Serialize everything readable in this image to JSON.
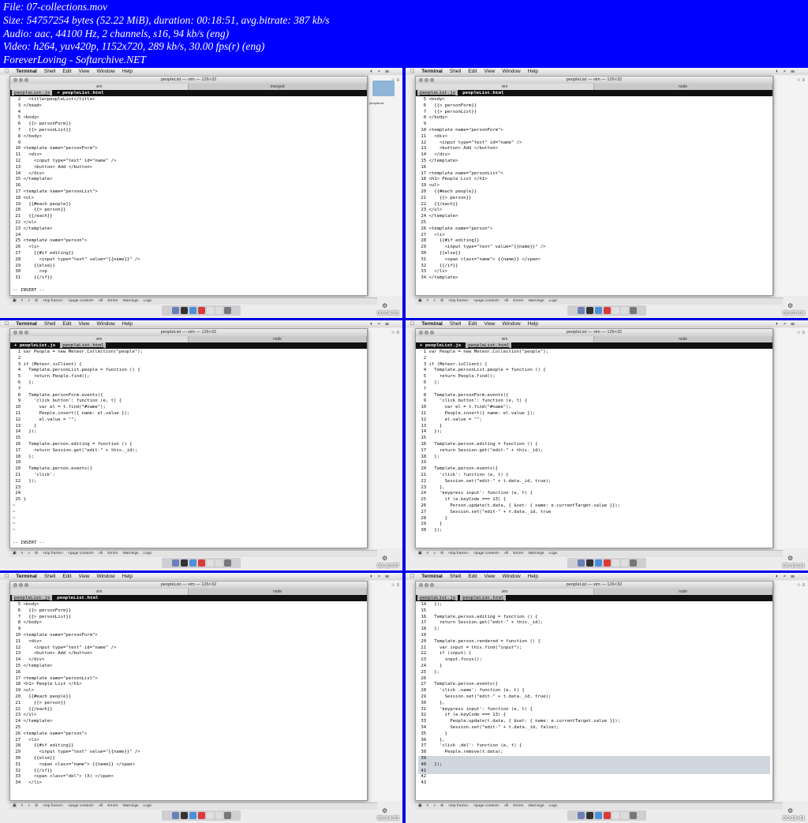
{
  "header": {
    "lines": [
      "File: 07-collections.mov",
      "Size: 54757254 bytes (52.22 MiB), duration: 00:18:51, avg.bitrate: 387 kb/s",
      "Audio: aac, 44100 Hz, 2 channels, s16, 94 kb/s (eng)",
      "Video: h264, yuv420p, 1152x720, 289 kb/s, 30.00 fps(r) (eng)",
      "ForeverLoving - Softarchive.NET"
    ]
  },
  "menubar": {
    "app": "Terminal",
    "items": [
      "Shell",
      "Edit",
      "View",
      "Window",
      "Help"
    ]
  },
  "window": {
    "title": "peopleList — vim — 126×32"
  },
  "devtools": {
    "top_frame": "<top frame>",
    "page_context": "<page context>",
    "count": "All",
    "errors": "Errors",
    "warnings": "Warnings",
    "logs": "Logs"
  },
  "panels": [
    {
      "timestamp": "00:04:51",
      "tabs": [
        "vim",
        "mongod"
      ],
      "buffers": [
        {
          "label": "peopleList.js",
          "active": false
        },
        {
          "label": "+ peopleList.html",
          "active": true
        }
      ],
      "show_folder": true,
      "folder_label": "peopleList",
      "insert_mode": "-- INSERT --",
      "lines": [
        "  2   <title>peopleList</title>",
        "  3 </head>",
        "  4",
        "  5 <body>",
        "  6   {{> personForm}}",
        "  7   {{> personList}}",
        "  8 </body>",
        "  9",
        " 10 <template name=\"personForm\">",
        " 11   <div>",
        " 12     <input type=\"text\" id=\"name\" />",
        " 13     <button> Add </button>",
        " 14   </div>",
        " 15 </template>",
        " 16",
        " 17 <template name=\"personList\">",
        " 18 <ul>",
        " 19   {{#each people}}",
        " 20     {{> person}}",
        " 21   {{/each}}",
        " 22 </ul>",
        " 23 </template>",
        " 24",
        " 25 <template name=\"person\">",
        " 26   <li>",
        " 27     {{#if editing}}",
        " 28       <input type=\"text\" value=\"{{name}}\" />",
        " 29     {{else}}",
        " 30       <sp",
        " 31     {{/if}}"
      ]
    },
    {
      "timestamp": "00:07:09",
      "tabs": [
        "vim",
        "node"
      ],
      "buffers": [
        {
          "label": "peopleList.js",
          "active": false
        },
        {
          "label": "peopleList.html",
          "active": true
        }
      ],
      "show_folder": false,
      "insert_mode": "",
      "lines": [
        "  5 <body>",
        "  6   {{> personForm}}",
        "  7   {{> personList}}",
        "  8 </body>",
        "  9",
        " 10 <template name=\"personForm\">",
        " 11   <div>",
        " 12     <input type=\"text\" id=\"name\" />",
        " 13     <button> Add </button>",
        " 14   </div>",
        " 15 </template>",
        " 16",
        " 17 <template name=\"personList\">",
        " 18 <h1> People List </h1>",
        " 19 <ul>",
        " 20   {{#each people}}",
        " 21     {{> person}}",
        " 22   {{/each}}",
        " 23 </ul>",
        " 24 </template>",
        " 25",
        " 26 <template name=\"person\">",
        " 27   <li>",
        " 28     {{#if editing}}",
        " 29       <input type=\"text\" value=\"{{name}}\" />",
        " 30     {{else}}",
        " 31       <span class=\"name\"> {{name}} </span>",
        " 32     {{/if}}",
        " 33   </li>",
        " 34 </template>"
      ]
    },
    {
      "timestamp": "00:10:37",
      "tabs": [
        "vim",
        "node"
      ],
      "buffers": [
        {
          "label": "+ peopleList.js",
          "active": true
        },
        {
          "label": "peopleList.html",
          "active": false
        }
      ],
      "show_folder": false,
      "insert_mode": "-- INSERT --",
      "lines": [
        "  1 var People = new Meteor.Collection(\"people\");",
        "  2",
        "  3 if (Meteor.isClient) {",
        "  4   Template.personList.people = function () {",
        "  5     return People.find();",
        "  6   };",
        "  7",
        "  8   Template.personForm.events({",
        "  9     'click button': function (e, t) {",
        " 10       var el = t.find(\"#name\");",
        " 11       People.insert({ name: el.value });",
        " 12       el.value = \"\";",
        " 13     }",
        " 14   });",
        " 15",
        " 16   Template.person.editing = function () {",
        " 17     return Session.get(\"edit-\" + this._id);",
        " 18   };",
        " 19",
        " 20   Template.person.events({",
        " 21     'click': ",
        " 22   });",
        " 23",
        " 24",
        " 25 }",
        "~",
        "~",
        "~",
        "~",
        "~"
      ]
    },
    {
      "timestamp": "00:13:31",
      "tabs": [
        "vim",
        "node"
      ],
      "buffers": [
        {
          "label": "+ peopleList.js",
          "active": true
        },
        {
          "label": "peopleList.html",
          "active": false
        }
      ],
      "show_folder": false,
      "insert_mode": "",
      "lines": [
        "  1 var People = new Meteor.Collection(\"people\");",
        "  2",
        "  3 if (Meteor.isClient) {",
        "  4   Template.personList.people = function () {",
        "  5     return People.find();",
        "  6   };",
        "  7",
        "  8   Template.personForm.events({",
        "  9     'click button': function (e, t) {",
        " 10       var el = t.find(\"#name\");",
        " 11       People.insert({ name: el.value });",
        " 12       el.value = \"\";",
        " 13     }",
        " 14   });",
        " 15",
        " 16   Template.person.editing = function () {",
        " 17     return Session.get(\"edit-\" + this._id);",
        " 18   };",
        " 19",
        " 20   Template.person.events({",
        " 21     'click': function (e, t) {",
        " 22       Session.set(\"edit-\" + t.data._id, true);",
        " 23     },",
        " 24     'keypress input': function (e, t) {",
        " 25       if (e.keyCode === 13) {",
        " 26         Person.update(t.data, { $set: { name: e.currentTarget.value }});",
        " 27         Session.set(\"edit-\" + t.data._id, true",
        " 28       }",
        " 29     }",
        " 30   });"
      ]
    },
    {
      "timestamp": "00:14:53",
      "tabs": [
        "vim",
        "node"
      ],
      "buffers": [
        {
          "label": "peopleList.js",
          "active": false
        },
        {
          "label": "peopleList.html",
          "active": true
        }
      ],
      "show_folder": false,
      "insert_mode": "",
      "lines": [
        "  5 <body>",
        "  6   {{> personForm}}",
        "  7   {{> personList}}",
        "  8 </body>",
        "  9",
        " 10 <template name=\"personForm\">",
        " 11   <div>",
        " 12     <input type=\"text\" id=\"name\" />",
        " 13     <button> Add </button>",
        " 14   </div>",
        " 15 </template>",
        " 16",
        " 17 <template name=\"personList\">",
        " 18 <h1> People List </h1>",
        " 19 <ul>",
        " 20   {{#each people}}",
        " 21     {{> person}}",
        " 22   {{/each}}",
        " 23 </ul>",
        " 24 </template>",
        " 25",
        " 26 <template name=\"person\">",
        " 27   <li>",
        " 28     {{#if editing}}",
        " 29       <input type=\"text\" value=\"{{name}}\" />",
        " 30     {{else}}",
        " 31       <span class=\"name\"> {{name}} </span>",
        " 32     {{/if}}",
        " 33     <span class=\"del\"> (X) </span>",
        " 34   </li>"
      ]
    },
    {
      "timestamp": "00:16:41",
      "tabs": [
        "vim",
        "node"
      ],
      "buffers": [
        {
          "label": "peopleList.js",
          "active": false
        },
        {
          "label": "peopleList.html",
          "active": false
        }
      ],
      "show_folder": false,
      "insert_mode": "",
      "lines": [
        " 14   });",
        " 15",
        " 16   Template.person.editing = function () {",
        " 17     return Session.get(\"edit-\" + this._id);",
        " 18   };",
        " 19",
        " 20   Template.person.rendered = function () {",
        " 21     var input = this.find(\"input\");",
        " 22     if (input) {",
        " 23       input.focus();",
        " 24     }",
        " 25   };",
        " 26",
        " 27   Template.person.events({",
        " 28     'click .name': function (e, t) {",
        " 29       Session.set(\"edit-\" + t.data._id, true);",
        " 30     },",
        " 31     'keypress input': function (e, t) {",
        " 32       if (e.keyCode === 13) {",
        " 33         People.update(t.data, { $set: { name: e.currentTarget.value }});",
        " 34         Session.set(\"edit-\" + t.data._id, false);",
        " 35       }",
        " 36     },",
        " 37     'click .del': function (e, t) {",
        " 38       People.remove(t.data);",
        " 39",
        " 40   });",
        " 41",
        " 42",
        " 43"
      ],
      "highlight_from": 25,
      "highlight_to": 27
    }
  ]
}
